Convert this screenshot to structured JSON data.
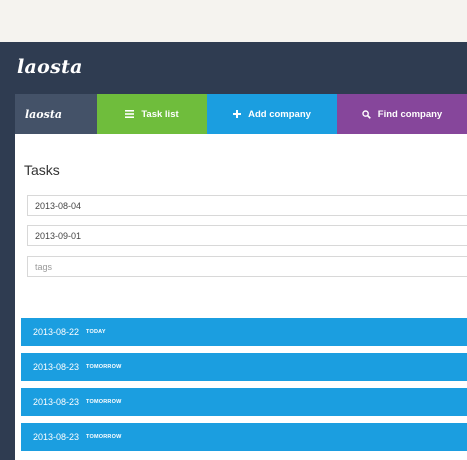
{
  "app": {
    "brand": "laosta"
  },
  "nav": {
    "logo": "laosta",
    "items": [
      {
        "label": "Task list",
        "icon": "list-icon"
      },
      {
        "label": "Add company",
        "icon": "plus-icon"
      },
      {
        "label": "Find company",
        "icon": "search-icon"
      }
    ]
  },
  "tasks_page": {
    "title": "Tasks",
    "filters": {
      "from_date": "2013-08-04",
      "to_date": "2013-09-01",
      "tags_placeholder": "tags"
    },
    "rows": [
      {
        "date": "2013-08-22",
        "tag": "TODAY"
      },
      {
        "date": "2013-08-23",
        "tag": "TOMORROW"
      },
      {
        "date": "2013-08-23",
        "tag": "TOMORROW"
      },
      {
        "date": "2013-08-23",
        "tag": "TOMORROW"
      }
    ]
  },
  "colors": {
    "app_background": "#2f3c51",
    "task_list": "#6fbd3c",
    "add_company": "#1b9ee0",
    "find_company": "#86469b",
    "task_row": "#1b9ee0"
  }
}
